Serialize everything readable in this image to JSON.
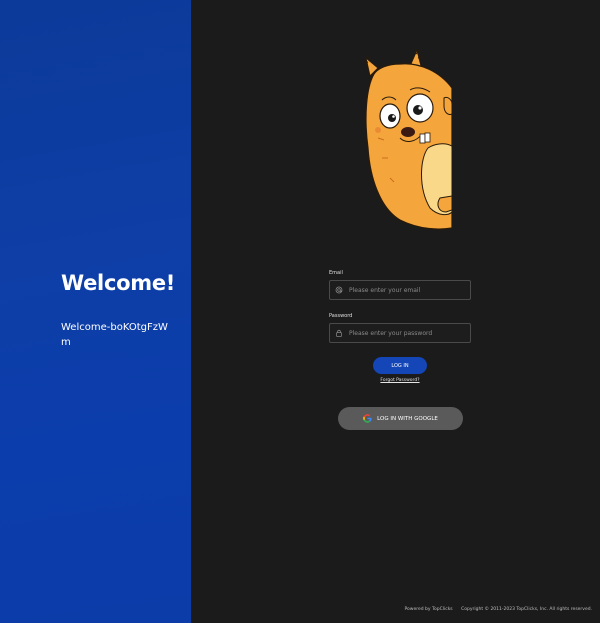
{
  "welcome": {
    "title": "Welcome!",
    "subtitle": "Welcome-boKOtgFzWm"
  },
  "login": {
    "email_label": "Email",
    "email_placeholder": "Please enter your email",
    "password_label": "Password",
    "password_placeholder": "Please enter your password",
    "login_button": "LOG IN",
    "forgot_password": "Forgot Password?",
    "google_button": "LOG IN WITH GOOGLE"
  },
  "footer": {
    "powered_by": "Powered by TopClicks",
    "copyright": "Copyright © 2011-2023 TopClicks, Inc. All rights reserved."
  },
  "icons": {
    "email": "at-icon",
    "password": "lock-icon",
    "google": "google-icon",
    "mascot": "squirrel-mascot"
  },
  "colors": {
    "left_panel": "#0e3ea6",
    "background": "#1b1b1b",
    "primary_button": "#1446b8",
    "google_button": "#5a5a5a",
    "mascot": "#f4a53c"
  }
}
